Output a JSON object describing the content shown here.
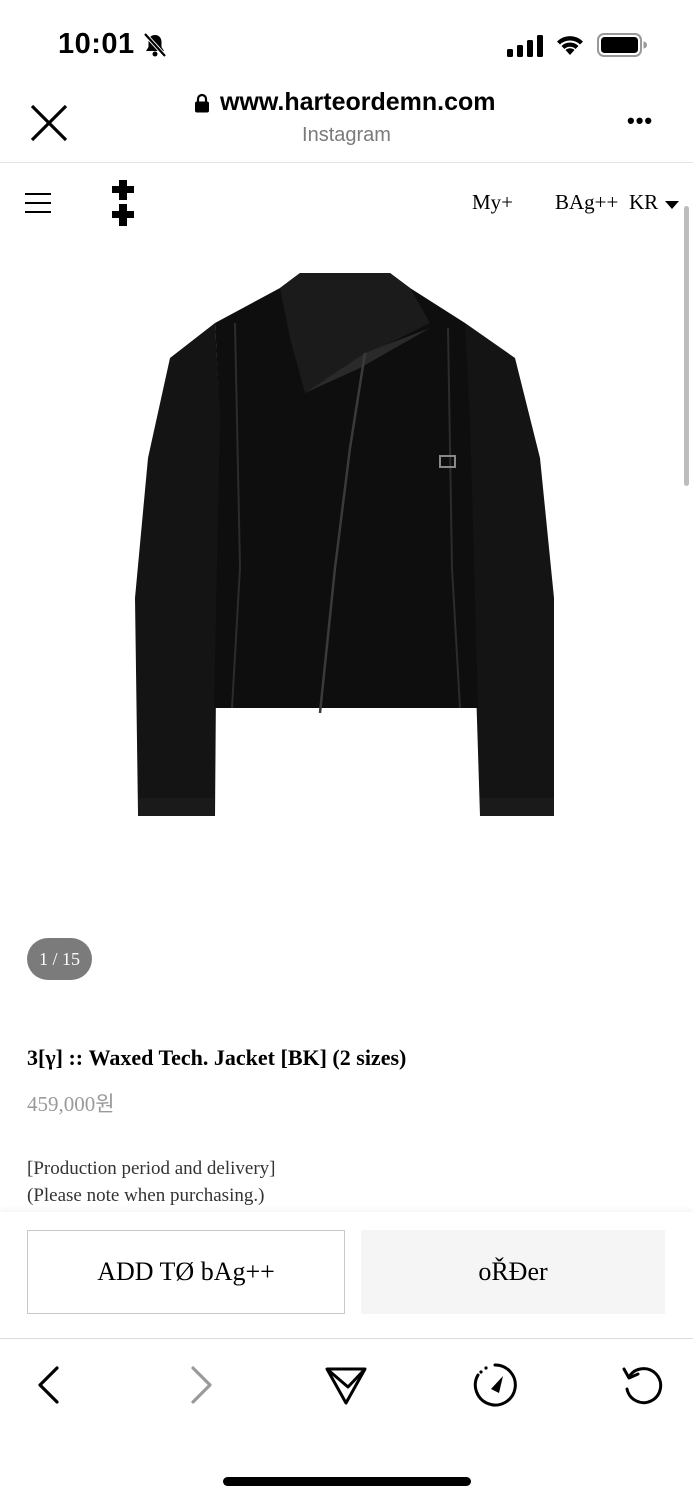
{
  "status_bar": {
    "time": "10:01"
  },
  "browser": {
    "url": "www.harteordemn.com",
    "source": "Instagram",
    "more_label": "•••"
  },
  "nav": {
    "my_label": "My+",
    "bag_label": "BAg++",
    "region_label": "KR"
  },
  "product": {
    "image_counter": "1 / 15",
    "title": "3[γ] :: Waxed Tech. Jacket [BK] (2 sizes)",
    "price": "459,000원",
    "info_line1": "[Production period and delivery]",
    "info_line2": "(Please note when purchasing.)"
  },
  "actions": {
    "add_to_bag_label": "ADD TØ bAg++",
    "order_label": "oŘĐer"
  },
  "colors": {
    "jacket": "#111111",
    "counter_bg": "#7b7b7b",
    "order_bg": "#f5f5f5",
    "price_gray": "#9a9a9a"
  },
  "icons": [
    "bell-slash-icon",
    "signal-icon",
    "wifi-icon",
    "battery-icon",
    "close-icon",
    "lock-icon",
    "menu-icon",
    "logo-icon",
    "caret-down-icon",
    "back-icon",
    "forward-icon",
    "share-icon",
    "compass-icon",
    "reload-icon"
  ]
}
